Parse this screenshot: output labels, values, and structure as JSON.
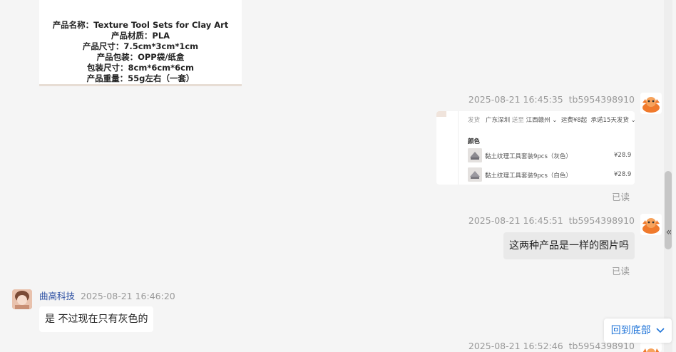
{
  "product_card": {
    "lines": [
      "产品名称：Texture Tool Sets for Clay Art",
      "产品材质：PLA",
      "产品尺寸：7.5cm*3cm*1cm",
      "产品包装：OPP袋/纸盒",
      "包装尺寸：8cm*6cm*6cm",
      "产品重量：55g左右（一套）"
    ]
  },
  "messages": {
    "m1": {
      "time": "2025-08-21 16:45:35",
      "user": "tb5954398910",
      "status": "已读"
    },
    "m1_screenshot": {
      "ship_label": "发货",
      "ship_from": "广东深圳",
      "ship_to_label": "送至",
      "ship_to": "江西赣州",
      "fee": "运费¥8起",
      "promise": "承诺15天发货",
      "color_label": "颜色",
      "rows": [
        {
          "name": "黏土纹理工具套装9pcs（灰色）",
          "price": "¥28.9"
        },
        {
          "name": "黏土纹理工具套装9pcs（白色）",
          "price": "¥28.9"
        }
      ]
    },
    "m2": {
      "time": "2025-08-21 16:45:51",
      "user": "tb5954398910",
      "text": "这两种产品是一样的图片吗",
      "status": "已读"
    },
    "m3": {
      "user": "曲高科技",
      "time": "2025-08-21 16:46:20",
      "text": "是 不过现在只有灰色的"
    },
    "m4": {
      "time": "2025-08-21 16:52:46",
      "user": "tb5954398910"
    }
  },
  "ui": {
    "scroll_bottom_label": "回到底部",
    "collapse_glyph": "«",
    "accent_color": "#1e73d8",
    "username_color": "#2b4ea2"
  }
}
